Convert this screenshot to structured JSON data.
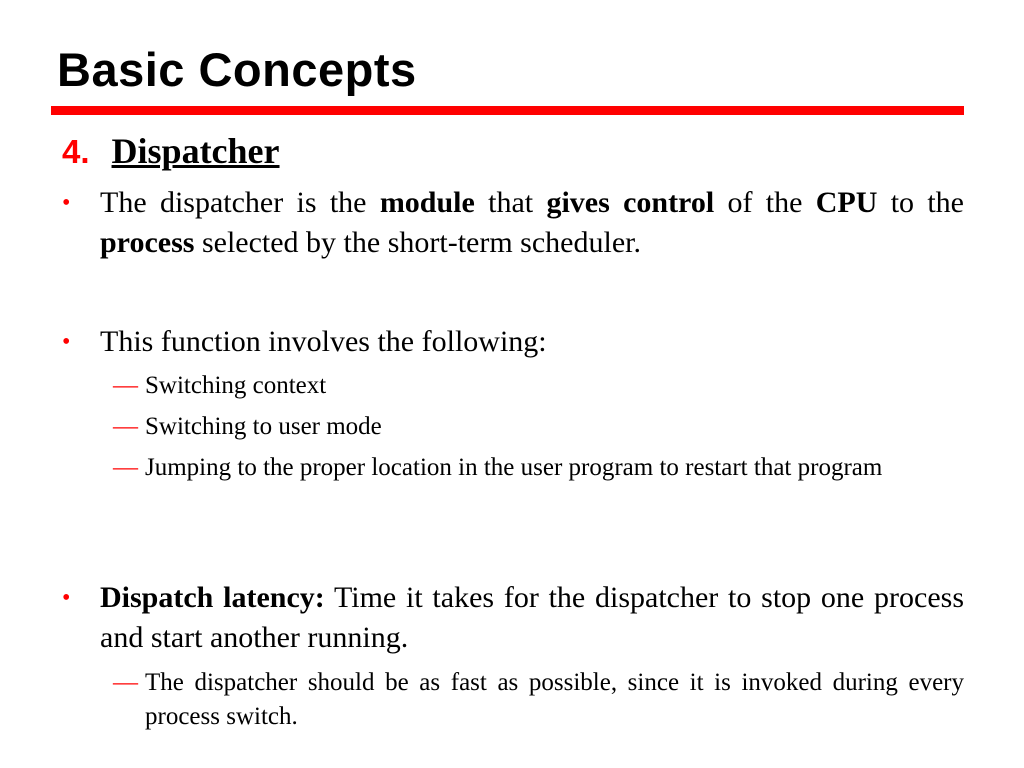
{
  "slide": {
    "title": "Basic Concepts",
    "accent_color": "#ff0000",
    "section": {
      "number": "4.",
      "name": "Dispatcher"
    },
    "bullet1": {
      "p1": "The dispatcher is the ",
      "b1": "module",
      "p2": " that ",
      "b2": "gives control",
      "p3": " of the ",
      "b3": "CPU",
      "p4": " to the ",
      "b4": "process",
      "p5": " selected by the short-term scheduler."
    },
    "bullet2": {
      "text": "This function involves the following:",
      "subitems": [
        "Switching context",
        "Switching to user mode",
        "Jumping to the proper location in the user program to restart that program"
      ]
    },
    "bullet3": {
      "bold": "Dispatch latency:",
      "text": " Time it takes for the dispatcher to stop one process and start another running.",
      "subitems": [
        "The dispatcher should be as fast as possible, since it is invoked during every process switch."
      ]
    },
    "bullet_glyph": "•",
    "sub_glyph": "—"
  }
}
